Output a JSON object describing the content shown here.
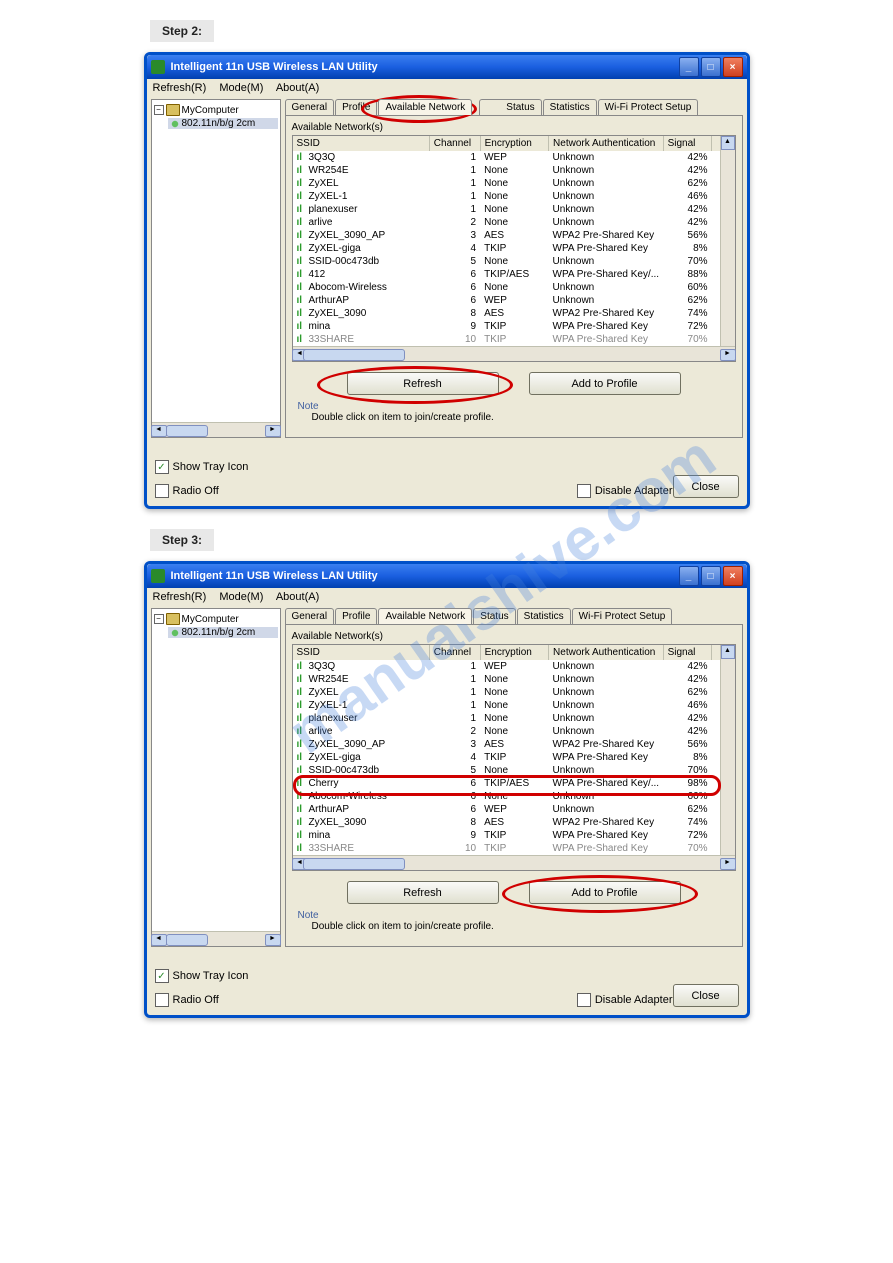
{
  "steps": {
    "two": "Step 2:",
    "three": "Step 3:"
  },
  "window": {
    "title": "Intelligent 11n USB Wireless LAN Utility",
    "menu": {
      "refresh": "Refresh(R)",
      "mode": "Mode(M)",
      "about": "About(A)"
    },
    "tree": {
      "root": "MyComputer",
      "child": "802.11n/b/g 2cm"
    },
    "tabs": [
      "General",
      "Profile",
      "Available Network",
      "Status",
      "Statistics",
      "Wi-Fi Protect Setup"
    ],
    "group_label": "Available Network(s)",
    "columns": [
      "SSID",
      "Channel",
      "Encryption",
      "Network Authentication",
      "Signal"
    ],
    "networks1": [
      {
        "ssid": "3Q3Q",
        "ch": 1,
        "enc": "WEP",
        "auth": "Unknown",
        "sig": "42%"
      },
      {
        "ssid": "WR254E",
        "ch": 1,
        "enc": "None",
        "auth": "Unknown",
        "sig": "42%"
      },
      {
        "ssid": "ZyXEL",
        "ch": 1,
        "enc": "None",
        "auth": "Unknown",
        "sig": "62%"
      },
      {
        "ssid": "ZyXEL-1",
        "ch": 1,
        "enc": "None",
        "auth": "Unknown",
        "sig": "46%"
      },
      {
        "ssid": "planexuser",
        "ch": 1,
        "enc": "None",
        "auth": "Unknown",
        "sig": "42%"
      },
      {
        "ssid": "arlive",
        "ch": 2,
        "enc": "None",
        "auth": "Unknown",
        "sig": "42%"
      },
      {
        "ssid": "ZyXEL_3090_AP",
        "ch": 3,
        "enc": "AES",
        "auth": "WPA2 Pre-Shared Key",
        "sig": "56%"
      },
      {
        "ssid": "ZyXEL-giga",
        "ch": 4,
        "enc": "TKIP",
        "auth": "WPA Pre-Shared Key",
        "sig": "8%"
      },
      {
        "ssid": "SSID-00c473db",
        "ch": 5,
        "enc": "None",
        "auth": "Unknown",
        "sig": "70%"
      },
      {
        "ssid": "412",
        "ch": 6,
        "enc": "TKIP/AES",
        "auth": "WPA Pre-Shared Key/...",
        "sig": "88%"
      },
      {
        "ssid": "Abocom-Wireless",
        "ch": 6,
        "enc": "None",
        "auth": "Unknown",
        "sig": "60%"
      },
      {
        "ssid": "ArthurAP",
        "ch": 6,
        "enc": "WEP",
        "auth": "Unknown",
        "sig": "62%"
      },
      {
        "ssid": "ZyXEL_3090",
        "ch": 8,
        "enc": "AES",
        "auth": "WPA2 Pre-Shared Key",
        "sig": "74%"
      },
      {
        "ssid": "mina",
        "ch": 9,
        "enc": "TKIP",
        "auth": "WPA Pre-Shared Key",
        "sig": "72%"
      }
    ],
    "networks2": [
      {
        "ssid": "3Q3Q",
        "ch": 1,
        "enc": "WEP",
        "auth": "Unknown",
        "sig": "42%"
      },
      {
        "ssid": "WR254E",
        "ch": 1,
        "enc": "None",
        "auth": "Unknown",
        "sig": "42%"
      },
      {
        "ssid": "ZyXEL",
        "ch": 1,
        "enc": "None",
        "auth": "Unknown",
        "sig": "62%"
      },
      {
        "ssid": "ZyXEL-1",
        "ch": 1,
        "enc": "None",
        "auth": "Unknown",
        "sig": "46%"
      },
      {
        "ssid": "planexuser",
        "ch": 1,
        "enc": "None",
        "auth": "Unknown",
        "sig": "42%"
      },
      {
        "ssid": "arlive",
        "ch": 2,
        "enc": "None",
        "auth": "Unknown",
        "sig": "42%"
      },
      {
        "ssid": "ZyXEL_3090_AP",
        "ch": 3,
        "enc": "AES",
        "auth": "WPA2 Pre-Shared Key",
        "sig": "56%"
      },
      {
        "ssid": "ZyXEL-giga",
        "ch": 4,
        "enc": "TKIP",
        "auth": "WPA Pre-Shared Key",
        "sig": "8%"
      },
      {
        "ssid": "SSID-00c473db",
        "ch": 5,
        "enc": "None",
        "auth": "Unknown",
        "sig": "70%"
      },
      {
        "ssid": "Cherry",
        "ch": 6,
        "enc": "TKIP/AES",
        "auth": "WPA Pre-Shared Key/...",
        "sig": "98%",
        "selected": true
      },
      {
        "ssid": "Abocom-Wireless",
        "ch": 6,
        "enc": "None",
        "auth": "Unknown",
        "sig": "60%"
      },
      {
        "ssid": "ArthurAP",
        "ch": 6,
        "enc": "WEP",
        "auth": "Unknown",
        "sig": "62%"
      },
      {
        "ssid": "ZyXEL_3090",
        "ch": 8,
        "enc": "AES",
        "auth": "WPA2 Pre-Shared Key",
        "sig": "74%"
      },
      {
        "ssid": "mina",
        "ch": 9,
        "enc": "TKIP",
        "auth": "WPA Pre-Shared Key",
        "sig": "72%"
      }
    ],
    "partial_row": {
      "ssid": "33SHARE",
      "ch": 10,
      "enc": "TKIP",
      "auth": "WPA Pre-Shared Key",
      "sig": "70%"
    },
    "buttons": {
      "refresh": "Refresh",
      "add": "Add to Profile",
      "close": "Close"
    },
    "note_label": "Note",
    "note_text": "Double click on item to join/create profile.",
    "checks": {
      "tray": "Show Tray Icon",
      "radio": "Radio Off",
      "disable": "Disable Adapter"
    }
  },
  "watermark": "manualshive.com"
}
